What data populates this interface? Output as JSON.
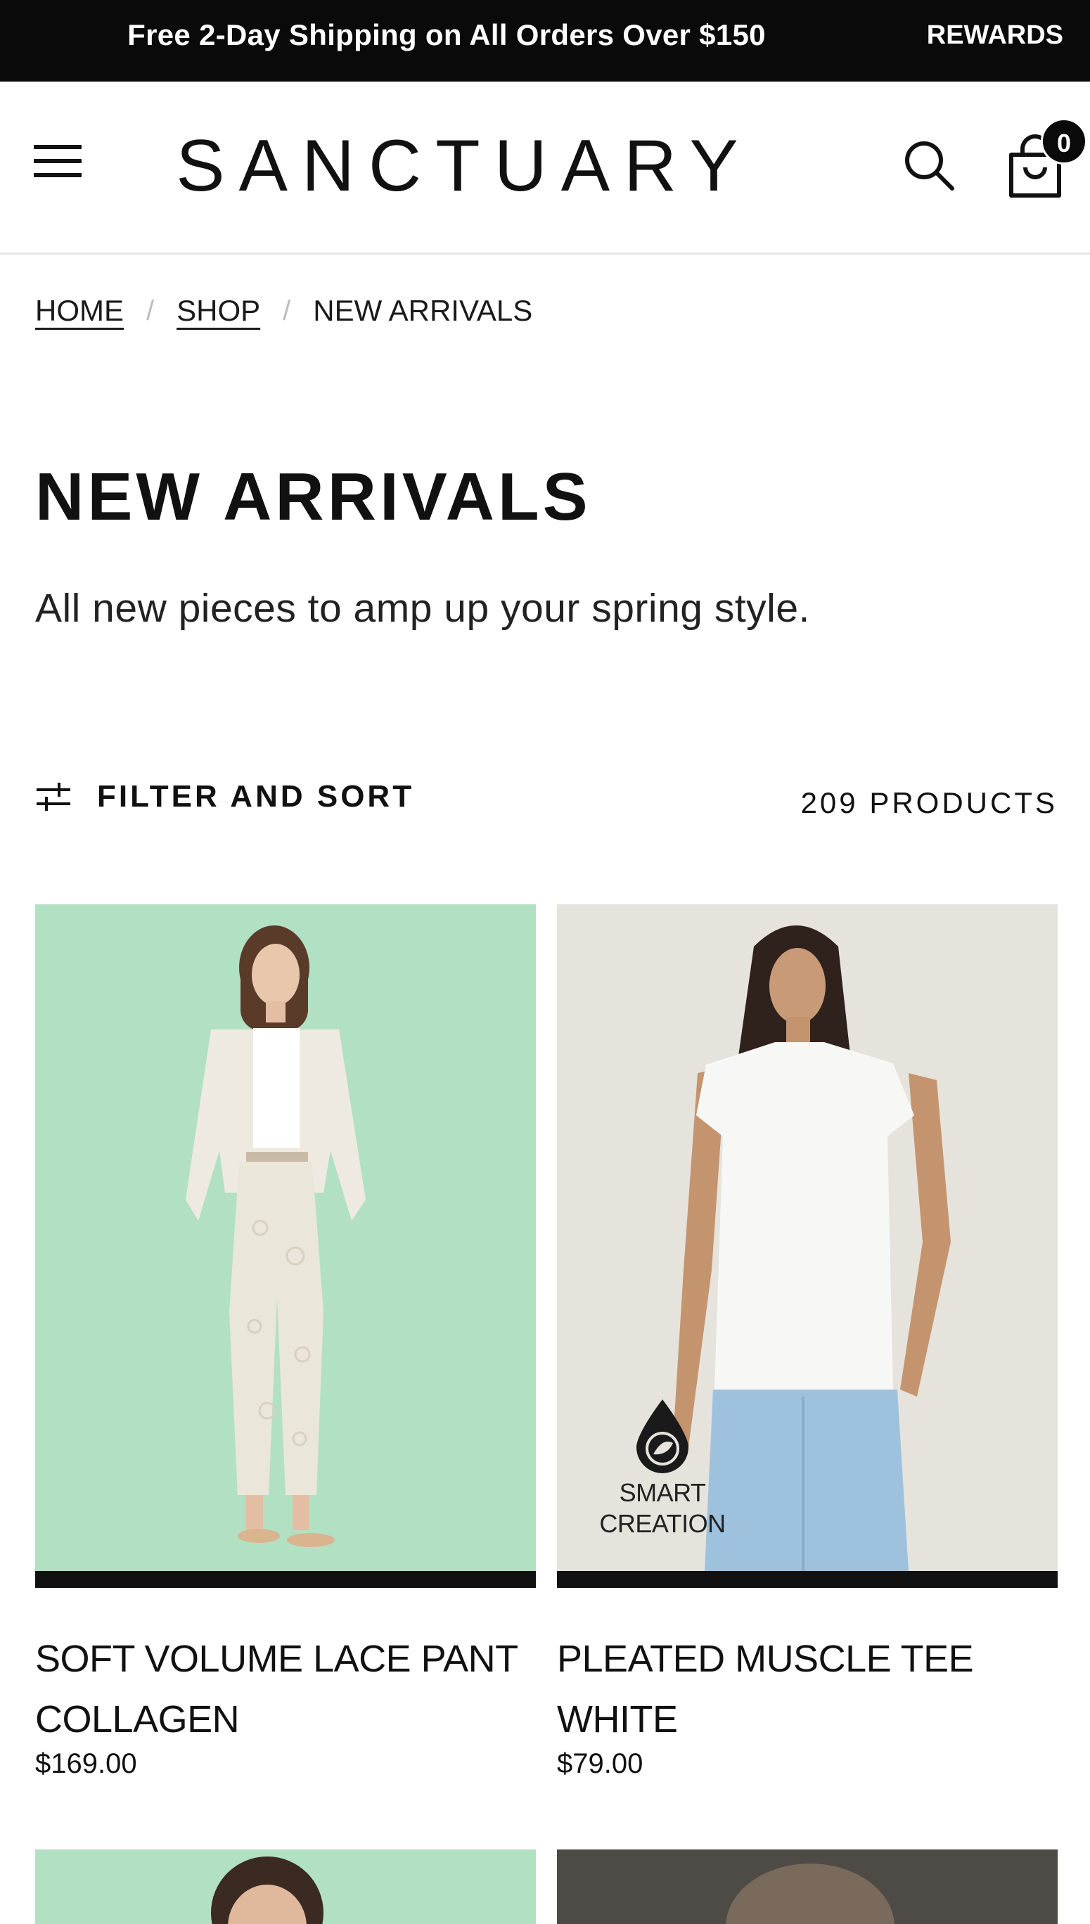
{
  "announcement": {
    "text": "Free 2-Day Shipping on All Orders Over $150",
    "rewards_label": "REWARDS"
  },
  "header": {
    "logo": "SANCTUARY",
    "cart_count": "0",
    "icons": [
      "hamburger-menu-icon",
      "search-icon",
      "shopping-bag-icon"
    ]
  },
  "breadcrumb": {
    "items": [
      {
        "label": "HOME",
        "link": true
      },
      {
        "label": "SHOP",
        "link": true
      },
      {
        "label": "NEW ARRIVALS",
        "link": false
      }
    ],
    "separator": "/"
  },
  "page": {
    "title": "NEW ARRIVALS",
    "description": "All new pieces to amp up your spring style."
  },
  "toolbar": {
    "filter_label": "FILTER AND SORT",
    "product_count": "209 PRODUCTS"
  },
  "products": [
    {
      "name": "SOFT VOLUME LACE PANT COLLAGEN",
      "price": "$169.00",
      "background": "#b2e0c3"
    },
    {
      "name": "PLEATED MUSCLE TEE WHITE",
      "price": "$79.00",
      "background": "#e6e3dc",
      "badge": "SMART CREATION"
    }
  ],
  "colors": {
    "announcement_bg": "#0a0a0a",
    "text": "#111111",
    "mint": "#b2e0c3",
    "stone": "#e6e3dc"
  }
}
